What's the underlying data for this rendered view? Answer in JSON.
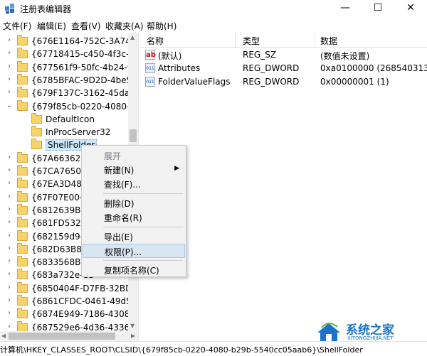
{
  "window": {
    "title": "注册表编辑器",
    "minimize_glyph": "—",
    "maximize_glyph": "☐",
    "close_glyph": "✕"
  },
  "menu": [
    "文件(F)",
    "编辑(E)",
    "查看(V)",
    "收藏夹(A)",
    "帮助(H)"
  ],
  "tree": {
    "items": [
      {
        "label": "{676E1164-752C-3A74-8D",
        "expandable": true,
        "expanded": false,
        "indent": 0
      },
      {
        "label": "{67718415-c450-4f3c-bf8a",
        "expandable": true,
        "expanded": false,
        "indent": 0
      },
      {
        "label": "{677561f9-50fc-4b24-921c",
        "expandable": true,
        "expanded": false,
        "indent": 0
      },
      {
        "label": "{6785BFAC-9D2D-4be5-B7",
        "expandable": true,
        "expanded": false,
        "indent": 0
      },
      {
        "label": "{679F137C-3162-45da-BE3",
        "expandable": true,
        "expanded": false,
        "indent": 0
      },
      {
        "label": "{679f85cb-0220-4080-b29",
        "expandable": true,
        "expanded": true,
        "indent": 0
      },
      {
        "label": "DefaultIcon",
        "expandable": false,
        "expanded": false,
        "indent": 1
      },
      {
        "label": "InProcServer32",
        "expandable": false,
        "expanded": false,
        "indent": 1
      },
      {
        "label": "ShellFolder",
        "expandable": false,
        "expanded": false,
        "indent": 1,
        "selected": true
      },
      {
        "label": "{67A66362-05",
        "expandable": true,
        "expanded": false,
        "indent": 0
      },
      {
        "label": "{67CA7650-96",
        "expandable": true,
        "expanded": false,
        "indent": 0
      },
      {
        "label": "{67EA3D48-83",
        "expandable": true,
        "expanded": false,
        "indent": 0
      },
      {
        "label": "{67F07E00-CC",
        "expandable": true,
        "expanded": false,
        "indent": 0
      },
      {
        "label": "{6812639B-FD",
        "expandable": true,
        "expanded": false,
        "indent": 0
      },
      {
        "label": "{681FD532-7E",
        "expandable": true,
        "expanded": false,
        "indent": 0
      },
      {
        "label": "{682159d9-c3",
        "expandable": true,
        "expanded": false,
        "indent": 0
      },
      {
        "label": "{682D63B8-16",
        "expandable": true,
        "expanded": false,
        "indent": 0
      },
      {
        "label": "{6833568B-54",
        "expandable": true,
        "expanded": false,
        "indent": 0
      },
      {
        "label": "{683a732e-ee",
        "expandable": true,
        "expanded": false,
        "indent": 0
      },
      {
        "label": "{6850404F-D7FB-32BD-83",
        "expandable": true,
        "expanded": false,
        "indent": 0
      },
      {
        "label": "{6861CFDC-0461-49d5-A8",
        "expandable": true,
        "expanded": false,
        "indent": 0
      },
      {
        "label": "{6874E949-7186-4308-A1E",
        "expandable": true,
        "expanded": false,
        "indent": 0
      },
      {
        "label": "{687529e6-4d36-4336-88e",
        "expandable": true,
        "expanded": false,
        "indent": 0
      }
    ]
  },
  "list": {
    "columns": [
      "名称",
      "类型",
      "数据"
    ],
    "rows": [
      {
        "icon": "string-value-icon",
        "icon_text": "ab",
        "name": "(默认)",
        "type": "REG_SZ",
        "data": "(数值未设置)"
      },
      {
        "icon": "dword-value-icon",
        "icon_text": "011",
        "name": "Attributes",
        "type": "REG_DWORD",
        "data": "0xa0100000 (2685403136)"
      },
      {
        "icon": "dword-value-icon",
        "icon_text": "011",
        "name": "FolderValueFlags",
        "type": "REG_DWORD",
        "data": "0x00000001 (1)"
      }
    ]
  },
  "context_menu": {
    "items": [
      {
        "label": "展开",
        "disabled": true
      },
      {
        "label": "新建(N)",
        "submenu": true
      },
      {
        "label": "查找(F)..."
      },
      {
        "separator": true
      },
      {
        "label": "删除(D)"
      },
      {
        "label": "重命名(R)"
      },
      {
        "separator": true
      },
      {
        "label": "导出(E)"
      },
      {
        "label": "权限(P)...",
        "hover": true
      },
      {
        "separator": true
      },
      {
        "label": "复制项名称(C)"
      }
    ]
  },
  "status": {
    "path": "计算机\\HKEY_CLASSES_ROOT\\CLSID\\{679f85cb-0220-4080-b29b-5540cc05aab6}\\ShellFolder"
  },
  "watermark": {
    "main": "系统之家",
    "sub": "XITONGZHIJIA.NET"
  },
  "colors": {
    "folder": "#f6d36b",
    "selection": "#cce8ff",
    "menu_hover": "#d8e6f2",
    "watermark": "#1b74c8"
  }
}
